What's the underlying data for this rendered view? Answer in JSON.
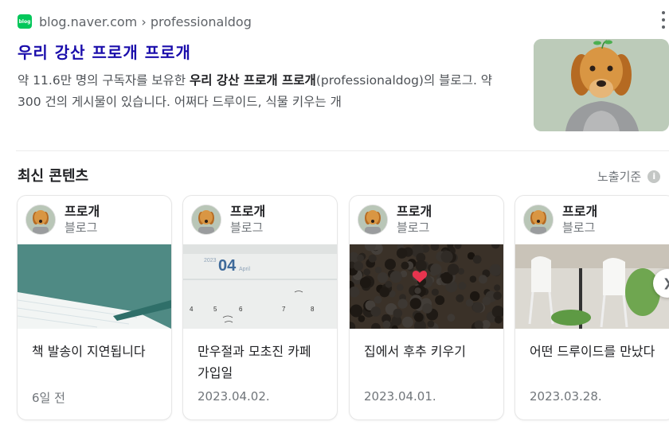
{
  "result": {
    "source_badge": "blog",
    "url": "blog.naver.com › professionaldog",
    "title": "우리 강산 프로개 프로개",
    "desc_prefix": "약 11.6만 명의 구독자를 보유한 ",
    "desc_bold": "우리 강산 프로개 프로개",
    "desc_suffix": "(professionaldog)의 블로그. 약 300 건의 게시물이 있습니다. 어쩌다 드루이드, 식물 키우는 개"
  },
  "section": {
    "title": "최신 콘텐츠",
    "sort_label": "노출기준",
    "info_glyph": "i"
  },
  "cards": [
    {
      "author": "프로개",
      "type": "블로그",
      "title": "책 발송이 지연됩니다",
      "date": "6일 전"
    },
    {
      "author": "프로개",
      "type": "블로그",
      "title": "만우절과 모초진 카페 가입일",
      "date": "2023.04.02.",
      "calendar": {
        "year": "2023",
        "day": "04",
        "month": "April"
      }
    },
    {
      "author": "프로개",
      "type": "블로그",
      "title": "집에서 후추 키우기",
      "date": "2023.04.01."
    },
    {
      "author": "프로개",
      "type": "블로그",
      "title": "어떤 드루이드를 만났다",
      "date": "2023.03.28."
    }
  ],
  "icons": {
    "more": "more-vertical-icon",
    "next": "chevron-right-icon",
    "heart": "heart-icon"
  },
  "colors": {
    "title_link": "#1a0dab",
    "brand_green": "#03c75a",
    "heart": "#e8344e"
  }
}
